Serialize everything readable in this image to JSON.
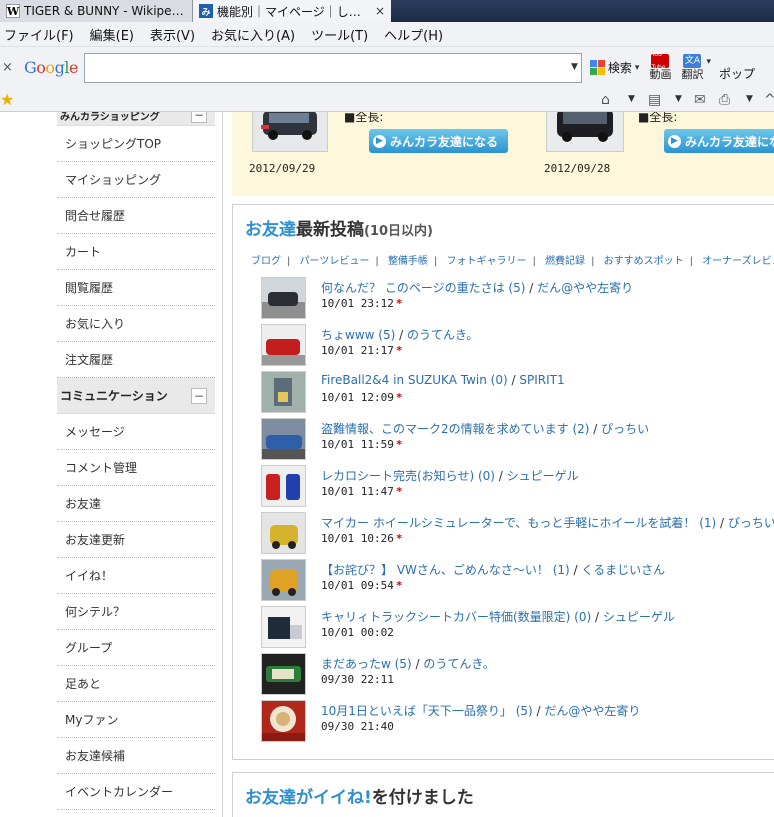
{
  "tabs": [
    {
      "label": "TIGER & BUNNY - Wikipedia",
      "favicon": "W",
      "active": false
    },
    {
      "label": "機能別｜マイページ｜しう...",
      "favicon": "み",
      "active": true,
      "close": "×"
    }
  ],
  "menu": [
    "ファイル(F)",
    "編集(E)",
    "表示(V)",
    "お気に入り(A)",
    "ツール(T)",
    "ヘルプ(H)"
  ],
  "toolbar": {
    "close": "×",
    "logo": [
      "G",
      "o",
      "o",
      "g",
      "l",
      "e"
    ],
    "search_label": "検索",
    "video_label": "動画",
    "video_icon": "You Tube",
    "translate_label": "翻訳",
    "popup_label": "ポップ"
  },
  "sidebar": {
    "top_head": "みんカラショッピング",
    "shop_items": [
      "ショッピングTOP",
      "マイショッピング",
      "問合せ履歴",
      "カート",
      "閲覧履歴",
      "お気に入り",
      "注文履歴"
    ],
    "comm_head": "コミュニケーション",
    "comm_items": [
      "メッセージ",
      "コメント管理",
      "お友達",
      "お友達更新",
      "イイね！",
      "何シテル？",
      "グループ",
      "足あと",
      "Myファン",
      "お友達候補",
      "イベントカレンダー"
    ],
    "minus": "−"
  },
  "suggest": [
    {
      "date": "2012/09/29",
      "text": "■全長:",
      "button": "みんカラ友達になる"
    },
    {
      "date": "2012/09/28",
      "text": "■全長:",
      "button": "みんカラ友達にな"
    }
  ],
  "friends_posts": {
    "title_blue": "お友達",
    "title_dark": "最新投稿",
    "title_small": "(10日以内)",
    "links": [
      "ブログ",
      "パーツレビュー",
      "整備手帳",
      "フォトギャラリー",
      "燃費記録",
      "おすすめスポット",
      "オーナーズレビュー･評価"
    ],
    "posts": [
      {
        "title": "何なんだ？ このページの重たさは (5)",
        "author": "だん@やや左寄り",
        "date": "10/01 23:12",
        "new": "*"
      },
      {
        "title": "ちょwww (5)",
        "author": "のうてんき。",
        "date": "10/01 21:17",
        "new": "*"
      },
      {
        "title": "FireBall2&4 in SUZUKA Twin (0)",
        "author": "SPIRIT1",
        "date": "10/01 12:09",
        "new": "*"
      },
      {
        "title": "盗難情報、このマーク2の情報を求めています (2)",
        "author": "ぴっちい",
        "date": "10/01 11:59",
        "new": "*"
      },
      {
        "title": "レカロシート完売(お知らせ) (0)",
        "author": "シュピーゲル",
        "date": "10/01 11:47",
        "new": "*"
      },
      {
        "title": "マイカー ホイールシミュレーターで、もっと手軽にホイールを試着！ (1)",
        "author": "ぴっちい",
        "date": "10/01 10:26",
        "new": "*"
      },
      {
        "title": "【お詫び？】 VWさん、ごめんなさ〜い！ (1)",
        "author": "くるまじいさん",
        "date": "10/01 09:54",
        "new": "*"
      },
      {
        "title": "キャリィトラックシートカバー特価(数量限定) (0)",
        "author": "シュピーゲル",
        "date": "10/01 00:02",
        "new": ""
      },
      {
        "title": "まだあったw (5)",
        "author": "のうてんき。",
        "date": "09/30 22:11",
        "new": ""
      },
      {
        "title": "10月1日といえば「天下一品祭り」 (5)",
        "author": "だん@やや左寄り",
        "date": "09/30 21:40",
        "new": ""
      }
    ]
  },
  "likes_panel": {
    "title_blue": "お友達がイイね!",
    "title_dark": "を付けました"
  }
}
